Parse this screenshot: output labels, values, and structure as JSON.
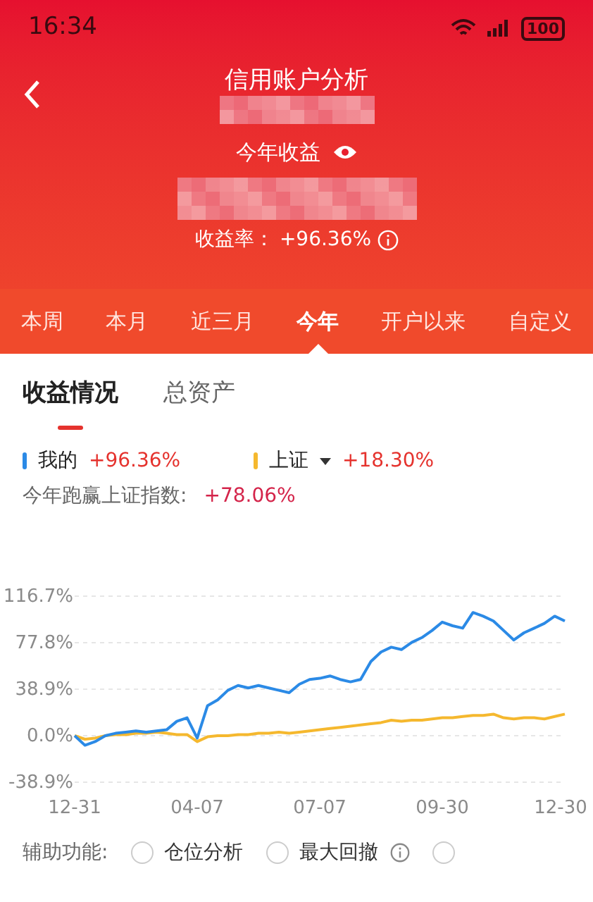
{
  "status_bar": {
    "time": "16:34",
    "battery": "100"
  },
  "header": {
    "title": "信用账户分析",
    "period_label": "今年收益",
    "rate_label": "收益率：",
    "rate_value": "+96.36%"
  },
  "period_tabs": [
    {
      "label": "本周",
      "selected": false
    },
    {
      "label": "本月",
      "selected": false
    },
    {
      "label": "近三月",
      "selected": false
    },
    {
      "label": "今年",
      "selected": true
    },
    {
      "label": "开户以来",
      "selected": false
    },
    {
      "label": "自定义",
      "selected": false
    }
  ],
  "section_tabs": [
    {
      "label": "收益情况",
      "selected": true
    },
    {
      "label": "总资产",
      "selected": false
    }
  ],
  "legend": [
    {
      "value": "+96.36%",
      "kind": "plain"
    },
    {
      "value": "+18.30%",
      "kind": "dropdown"
    }
  ],
  "comparison": {
    "label": "今年跑赢上证指数:",
    "value": "+78.06%"
  },
  "chart_data": {
    "type": "line",
    "categories": [
      "12-31",
      null,
      null,
      null,
      null,
      null,
      null,
      null,
      null,
      null,
      null,
      null,
      "04-07",
      null,
      null,
      null,
      null,
      null,
      null,
      null,
      null,
      null,
      null,
      null,
      "07-07",
      null,
      null,
      null,
      null,
      null,
      null,
      null,
      null,
      null,
      null,
      null,
      "09-30",
      null,
      null,
      null,
      null,
      null,
      null,
      null,
      null,
      null,
      null,
      null,
      "12-30"
    ],
    "series": [
      {
        "name": "我的",
        "color": "#2b8ae6",
        "values": [
          0,
          -8,
          -5,
          0,
          2,
          3,
          4,
          3,
          4,
          5,
          12,
          15,
          -2,
          25,
          30,
          38,
          42,
          40,
          42,
          40,
          38,
          36,
          43,
          47,
          48,
          50,
          47,
          45,
          47,
          62,
          70,
          74,
          72,
          78,
          82,
          88,
          95,
          92,
          90,
          103,
          100,
          96,
          88,
          80,
          86,
          90,
          94,
          100,
          96
        ]
      },
      {
        "name": "上证",
        "color": "#f5b82e",
        "values": [
          0,
          -3,
          -2,
          0,
          1,
          1,
          2,
          2,
          3,
          2,
          1,
          1,
          -5,
          -1,
          0,
          0,
          1,
          1,
          2,
          2,
          3,
          2,
          3,
          4,
          5,
          6,
          7,
          8,
          9,
          10,
          11,
          13,
          12,
          13,
          13,
          14,
          15,
          15,
          16,
          17,
          17,
          18,
          15,
          14,
          15,
          15,
          14,
          16,
          18
        ]
      }
    ],
    "yticks": [
      {
        "value": 116.7,
        "label": "116.7%"
      },
      {
        "value": 77.8,
        "label": "77.8%"
      },
      {
        "value": 38.9,
        "label": "38.9%"
      },
      {
        "value": 0,
        "label": "0.0%"
      },
      {
        "value": -38.9,
        "label": "-38.9%"
      }
    ],
    "ylim": [
      -38.9,
      116.7
    ],
    "grid": true
  },
  "aux": {
    "label": "辅助功能:",
    "options": [
      {
        "label": "仓位分析",
        "selected": false,
        "has_info": false
      },
      {
        "label": "最大回撤",
        "selected": false,
        "has_info": true
      },
      {
        "selected": false,
        "has_info": false
      }
    ]
  }
}
